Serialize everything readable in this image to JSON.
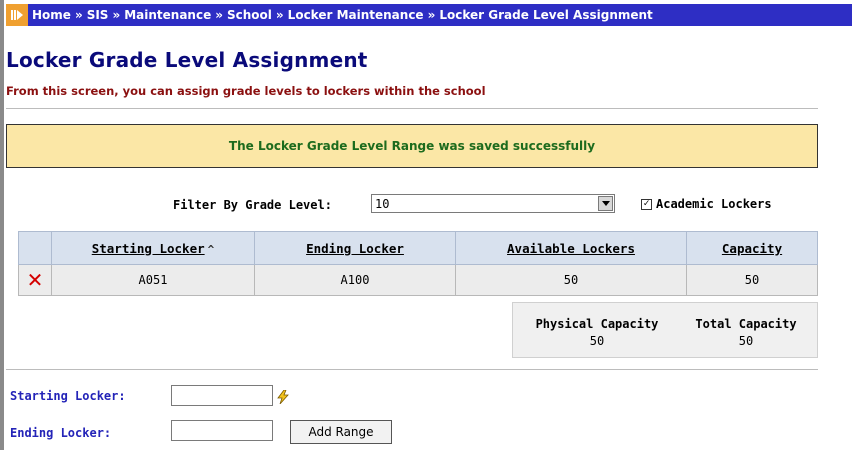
{
  "breadcrumb": [
    "Home",
    "SIS",
    "Maintenance",
    "School",
    "Locker Maintenance",
    "Locker Grade Level Assignment"
  ],
  "breadcrumb_separator": "»",
  "page": {
    "title": "Locker Grade Level Assignment",
    "subtitle": "From this screen, you can assign grade levels to lockers within the school"
  },
  "message": "The Locker Grade Level Range was saved successfully",
  "filter": {
    "label": "Filter By Grade Level:",
    "selected_value": "10",
    "checkbox_label": "Academic Lockers",
    "checkbox_checked": true
  },
  "table": {
    "headers": [
      "Starting Locker",
      "Ending Locker",
      "Available Lockers",
      "Capacity"
    ],
    "rows": [
      {
        "starting": "A051",
        "ending": "A100",
        "available": "50",
        "capacity": "50"
      }
    ]
  },
  "capacity_summary": {
    "physical_label": "Physical Capacity",
    "physical_value": "50",
    "total_label": "Total Capacity",
    "total_value": "50"
  },
  "form": {
    "starting_label": "Starting Locker:",
    "ending_label": "Ending Locker:",
    "starting_value": "",
    "ending_value": "",
    "add_button_label": "Add Range"
  },
  "colors": {
    "breadcrumb_bg": "#2e2ec4",
    "title": "#0a0a7a",
    "subtitle": "#8b1010",
    "success_bg": "#fbe7a6",
    "success_text": "#1d6b1d",
    "delete_icon": "#d40000"
  },
  "icons": [
    "breadcrumb-nav-icon",
    "sort-ascending-icon",
    "delete-x-icon",
    "dropdown-arrow-icon",
    "lightning-lookup-icon",
    "checkmark-icon"
  ]
}
